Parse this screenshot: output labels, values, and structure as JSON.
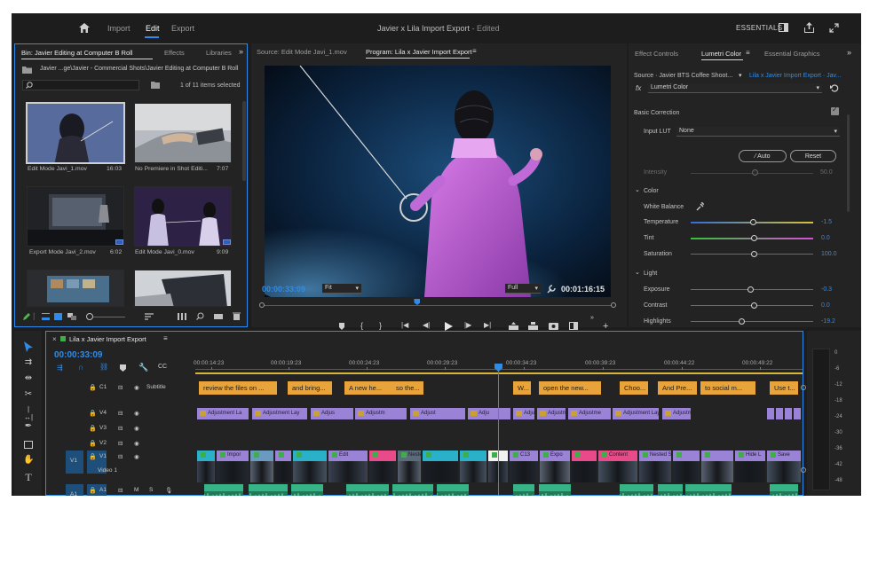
{
  "workspace": {
    "tabs": [
      "Import",
      "Edit",
      "Export"
    ],
    "active": "Edit",
    "doc_title": "Javier x Lila Import Export",
    "doc_status": "- Edited",
    "workspace_name": "ESSENTIALS"
  },
  "project": {
    "tabs": [
      "Bin: Javier Editing at Computer B Roll",
      "Effects",
      "Libraries"
    ],
    "path": "Javier ...ge\\Javier - Commercial Shots\\Javier Editing at Computer B Roll",
    "selection_count": "1 of 11 items selected",
    "items": [
      {
        "name": "Edit Mode Javi_1.mov",
        "duration": "16:03"
      },
      {
        "name": "No Premiere in Shot Editi...",
        "duration": "7:07"
      },
      {
        "name": "Export Mode Javi_2.mov",
        "duration": "6:02"
      },
      {
        "name": "Edit Mode Javi_0.mov",
        "duration": "9:09"
      }
    ]
  },
  "monitor": {
    "source_tab": "Source: Edit Mode Javi_1.mov",
    "program_tab": "Program: Lila x Javier Import Export",
    "timecode": "00:00:33:09",
    "zoom": "Fit",
    "resolution": "Full",
    "duration": "00:01:16:15",
    "playhead_fraction": 0.44
  },
  "lumetri": {
    "tabs": [
      "Effect Controls",
      "Lumetri Color",
      "Essential Graphics"
    ],
    "source": "Source · Javier BTS Coffee Shoot...",
    "target": "Lila x Javier Import Export · Jav...",
    "effect": "Lumetri Color",
    "basic_correction": "Basic Correction",
    "input_lut_label": "Input LUT",
    "input_lut_value": "None",
    "auto": "Auto",
    "reset": "Reset",
    "intensity_label": "Intensity",
    "intensity_value": "50.0",
    "color_section": "Color",
    "white_balance": "White Balance",
    "light_section": "Light",
    "sliders": [
      {
        "label": "Temperature",
        "value": "-1.5"
      },
      {
        "label": "Tint",
        "value": "0.0"
      },
      {
        "label": "Saturation",
        "value": "100.0"
      },
      {
        "label": "Exposure",
        "value": "-0.3"
      },
      {
        "label": "Contrast",
        "value": "0.0"
      },
      {
        "label": "Highlights",
        "value": "-19.2"
      }
    ]
  },
  "timeline": {
    "sequence_name": "Lila x Javier Import Export",
    "timecode": "00:00:33:09",
    "ruler": [
      "00:00:14:23",
      "00:00:19:23",
      "00:00:24:23",
      "00:00:29:23",
      "00:00:34:23",
      "00:00:39:23",
      "00:00:44:22",
      "00:00:49:22"
    ],
    "tracks": [
      {
        "id": "C1",
        "name": "Subtitle"
      },
      {
        "id": "V4",
        "name": ""
      },
      {
        "id": "V3",
        "name": ""
      },
      {
        "id": "V2",
        "name": ""
      },
      {
        "id": "V1",
        "name": "Video 1",
        "source": "V1"
      },
      {
        "id": "A1",
        "name": "",
        "source": "A1"
      }
    ],
    "subtitles": [
      "review the files on ...",
      "and bring...",
      "A new he...",
      "so the...",
      "W...",
      "open the new...",
      "Choo...",
      "And Pre...",
      "to social m...",
      "Use t..."
    ],
    "v4_clips": [
      "Adjustment La",
      "Adjustment Lay",
      "Adjus",
      "Adjustm",
      "Adjust",
      "Adju",
      "Adju",
      "Adjustment L",
      "Adjustme",
      "Adjustment Layer",
      "Adjustment L"
    ],
    "v1_clips": [
      "Impor",
      "Edit",
      "Nested S",
      "C13",
      "Expo",
      "Content",
      "Nested S",
      "Hide L",
      "Save"
    ],
    "a1_header": "S",
    "a1_mic": "mic"
  },
  "meters": {
    "scale": [
      "0",
      "-6",
      "-12",
      "-18",
      "-24",
      "-30",
      "-36",
      "-42",
      "-48"
    ]
  }
}
